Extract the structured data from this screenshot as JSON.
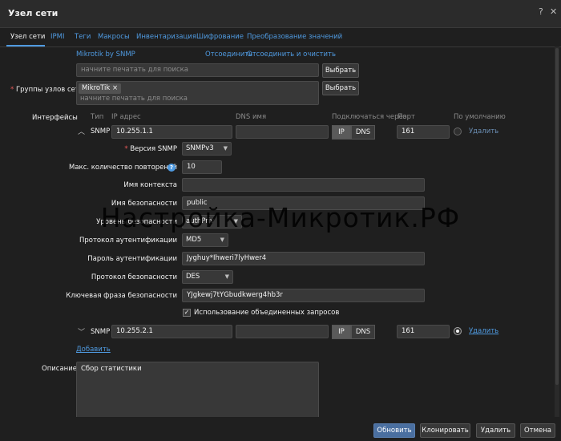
{
  "window": {
    "title": "Узел сети"
  },
  "tabs": [
    "Узел сети",
    "IPMI",
    "Теги",
    "Макросы",
    "Инвентаризация",
    "Шифрование",
    "Преобразование значений"
  ],
  "templates": {
    "linked_name": "Mikrotik by SNMP",
    "unlink": "Отсоединить",
    "unlink_clear": "Отсоединить и очистить",
    "search_placeholder": "начните печатать для поиска",
    "select_button": "Выбрать"
  },
  "groups": {
    "label": "Группы узлов сети",
    "required_mark": "*",
    "tag": "MikroTik",
    "tag_remove": "×",
    "search_placeholder": "начните печатать для поиска",
    "select_button": "Выбрать"
  },
  "interfaces": {
    "label": "Интерфейсы",
    "headers": {
      "type": "Тип",
      "ip": "IP адрес",
      "dns": "DNS имя",
      "connect": "Подключаться через",
      "port": "Порт",
      "default": "По умолчанию"
    },
    "snmp1": {
      "type": "SNMP",
      "ip": "10.255.1.1",
      "dns": "",
      "ip_btn": "IP",
      "dns_btn": "DNS",
      "port": "161",
      "remove": "Удалить",
      "fields": {
        "version_label": "Версия SNMP",
        "version_value": "SNMPv3",
        "retries_label": "Макс. количество повторений",
        "retries_value": "10",
        "context_label": "Имя контекста",
        "context_value": "",
        "secname_label": "Имя безопасности",
        "secname_value": "public",
        "seclevel_label": "Уровень безопасности",
        "seclevel_value": "authPriv",
        "authproto_label": "Протокол аутентификации",
        "authproto_value": "MD5",
        "authpass_label": "Пароль аутентификации",
        "authpass_value": "Jyghuy*Ihweri7lyHwer4",
        "privproto_label": "Протокол безопасности",
        "privproto_value": "DES",
        "privpass_label": "Ключевая фраза безопасности",
        "privpass_value": "YJgkewj7tYGbudkwerg4hb3r",
        "bulk_label": "Использование объединенных запросов"
      }
    },
    "snmp2": {
      "type": "SNMP",
      "ip": "10.255.2.1",
      "dns": "",
      "ip_btn": "IP",
      "dns_btn": "DNS",
      "port": "161",
      "remove": "Удалить"
    },
    "add": "Добавить"
  },
  "description": {
    "label": "Описание",
    "value": "Сбор статистики"
  },
  "watermark": "Настройка-Микротик.РФ",
  "footer": {
    "update": "Обновить",
    "clone": "Клонировать",
    "delete": "Удалить",
    "cancel": "Отмена"
  },
  "icons": {
    "help": "help-icon",
    "close": "close-icon",
    "collapse": "chevron-up-icon",
    "expand": "chevron-down-icon"
  },
  "colors": {
    "accent": "#4f9ae0",
    "background": "#1f1f1f",
    "required": "#e45959"
  }
}
